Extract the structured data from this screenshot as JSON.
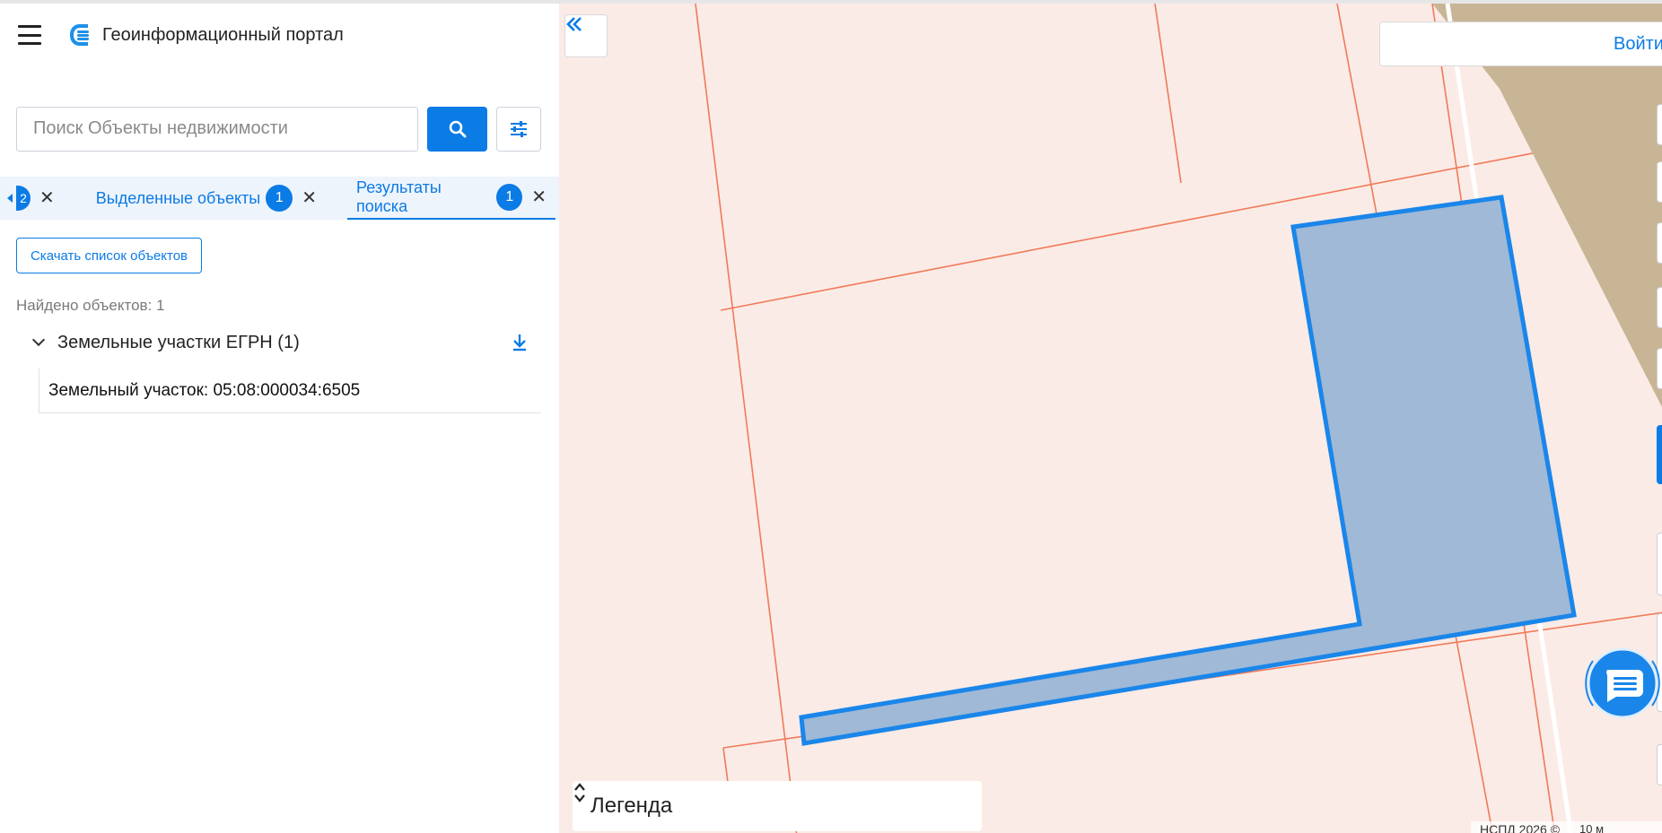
{
  "header": {
    "title": "Геоинформационный портал"
  },
  "search": {
    "placeholder": "Поиск Объекты недвижимости"
  },
  "tabs": {
    "partial_count": "2",
    "items": [
      {
        "label": "Выделенные объекты",
        "count": "1"
      },
      {
        "label": "Результаты поиска",
        "count": "1"
      }
    ]
  },
  "results": {
    "download_label": "Скачать список объектов",
    "found_text": "Найдено объектов: 1",
    "group_label": "Земельные участки ЕГРН (1)",
    "items": [
      {
        "label": "Земельный участок: 05:08:000034:6505"
      }
    ]
  },
  "map": {
    "login_label": "Войти",
    "legend_label": "Легенда",
    "attribution": "НСПД 2026 ©",
    "scale_label": "10 м"
  },
  "colors": {
    "accent": "#0b7be6",
    "map_background": "#fbebe6",
    "parcel_boundary": "#f07a5a",
    "selected_fill": "#9fb9d6",
    "selected_stroke": "#1a86ea"
  }
}
